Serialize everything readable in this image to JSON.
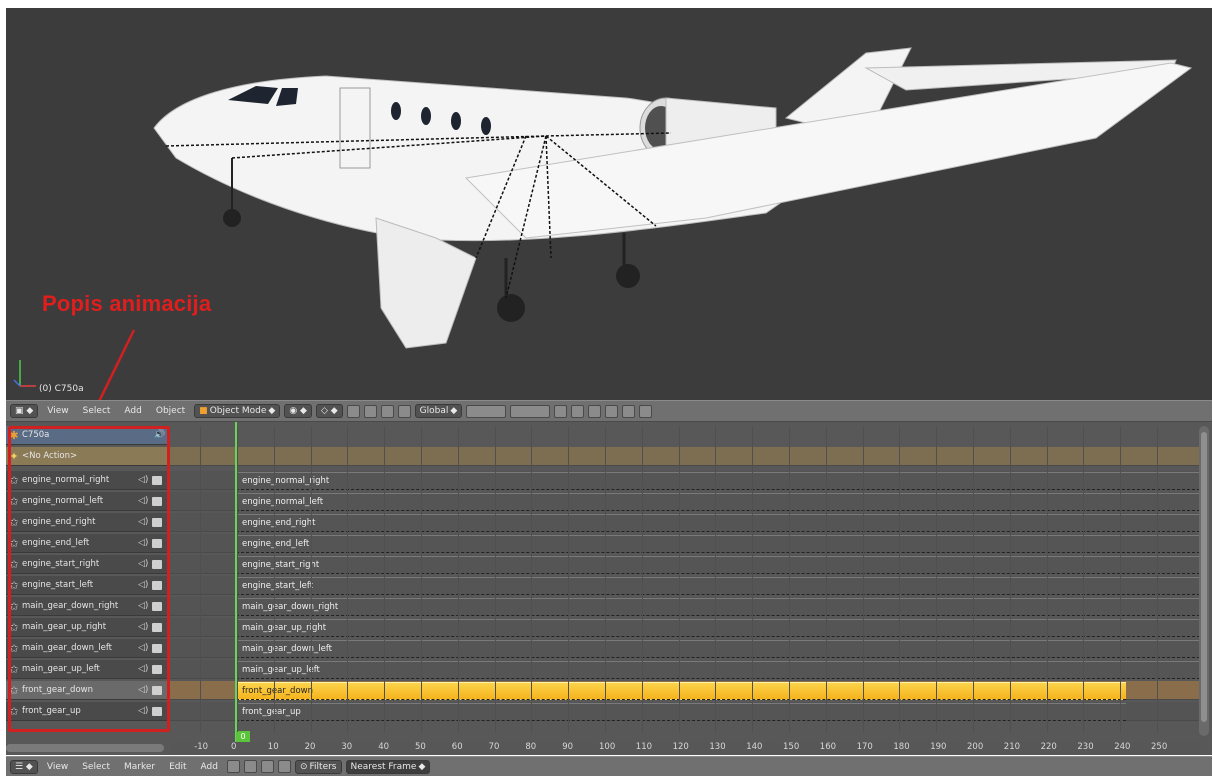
{
  "viewport": {
    "object_label": "(0) C750a",
    "annotation": "Popis animacija"
  },
  "header": {
    "menus": [
      "View",
      "Select",
      "Add",
      "Object"
    ],
    "mode": "Object Mode",
    "orientation": "Global"
  },
  "nla": {
    "object": "C750a",
    "action": "<No Action>",
    "tracks": [
      {
        "name": "engine_normal_right",
        "strip": "engine_normal_right",
        "selected": false
      },
      {
        "name": "engine_normal_left",
        "strip": "engine_normal_left",
        "selected": false
      },
      {
        "name": "engine_end_right",
        "strip": "engine_end_right",
        "selected": false
      },
      {
        "name": "engine_end_left",
        "strip": "engine_end_left",
        "selected": false
      },
      {
        "name": "engine_start_right",
        "strip": "engine_start_right",
        "selected": false
      },
      {
        "name": "engine_start_left",
        "strip": "engine_start_left",
        "selected": false
      },
      {
        "name": "main_gear_down_right",
        "strip": "main_gear_down_right",
        "selected": false
      },
      {
        "name": "main_gear_up_right",
        "strip": "main_gear_up_right",
        "selected": false
      },
      {
        "name": "main_gear_down_left",
        "strip": "main_gear_down_left",
        "selected": false
      },
      {
        "name": "main_gear_up_left",
        "strip": "main_gear_up_left",
        "selected": false
      },
      {
        "name": "front_gear_down",
        "strip": "front_gear_down",
        "selected": true
      },
      {
        "name": "front_gear_up",
        "strip": "front_gear_up",
        "selected": false
      }
    ],
    "current_frame": "0",
    "ruler_ticks": [
      "-10",
      "0",
      "10",
      "20",
      "30",
      "40",
      "50",
      "60",
      "70",
      "80",
      "90",
      "100",
      "110",
      "120",
      "130",
      "140",
      "150",
      "160",
      "170",
      "180",
      "190",
      "200",
      "210",
      "220",
      "230",
      "240",
      "250"
    ]
  },
  "footer": {
    "menus": [
      "View",
      "Select",
      "Marker",
      "Edit",
      "Add"
    ],
    "filters": "Filters",
    "snap": "Nearest Frame"
  },
  "colors": {
    "viewport_bg": "#3c3c3c",
    "selected_strip": "#f5b31e",
    "annotation_red": "#d12020",
    "frame_cursor": "#6ad35a"
  }
}
